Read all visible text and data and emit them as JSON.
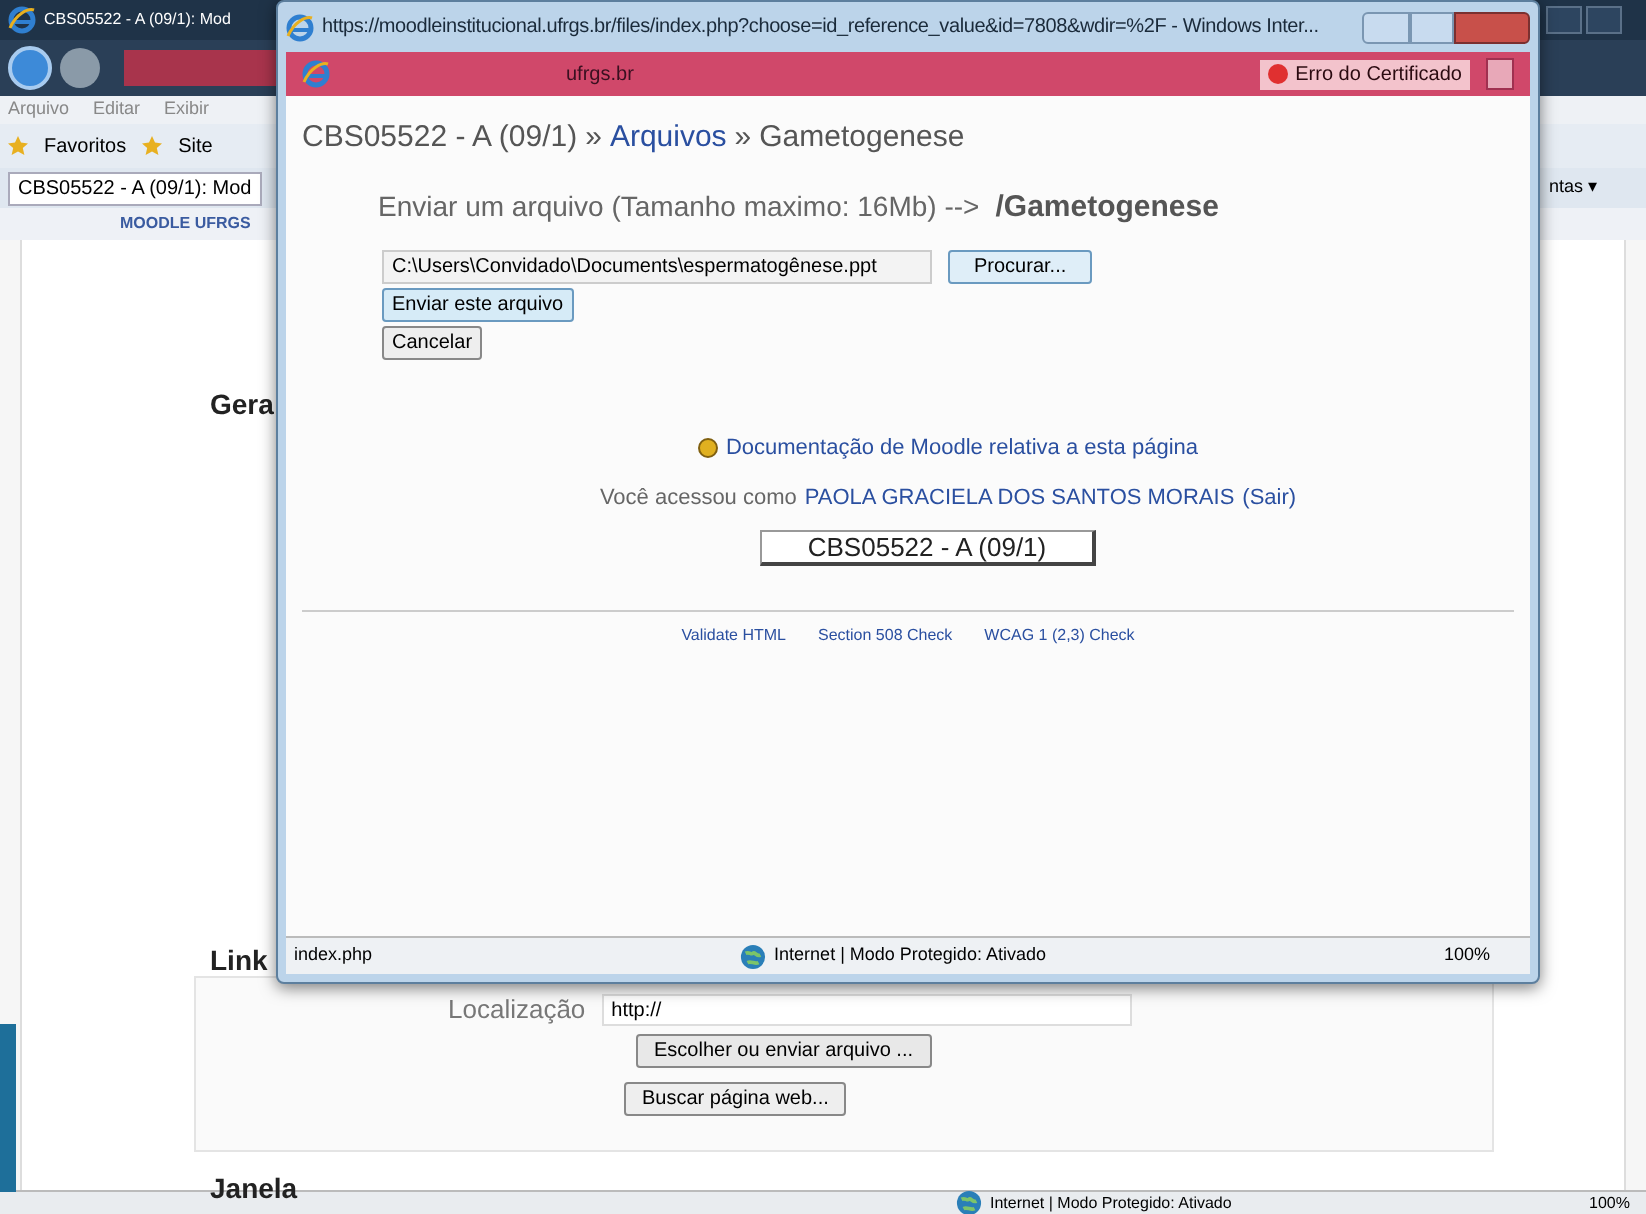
{
  "background_window": {
    "title": "CBS05522 - A (09/1): Mod",
    "menu": [
      "Arquivo",
      "Editar",
      "Exibir"
    ],
    "favorites": {
      "label": "Favoritos",
      "site": "Site"
    },
    "tab": "CBS05522 - A (09/1): Mod",
    "tools": "ntas ▾",
    "header": "MOODLE UFRGS",
    "sections": [
      {
        "label": "Gera"
      },
      {
        "label": "Link"
      },
      {
        "label": "Janela"
      }
    ],
    "location": {
      "label": "Localização",
      "value": "http://"
    },
    "buttons": [
      "Escolher ou enviar arquivo ...",
      "Buscar página web..."
    ],
    "status_bar": {
      "zone": "Internet | Modo Protegido: Ativado",
      "zoom": "100%"
    }
  },
  "popup": {
    "title": "https://moodleinstitucional.ufrgs.br/files/index.php?choose=id_reference_value&id=7808&wdir=%2F - Windows Inter...",
    "address": "ufrgs.br",
    "certificate_error": "Erro do Certificado",
    "breadcrumb_separator": "»",
    "breadcrumb": [
      {
        "label": "CBS05522 - A (09/1)",
        "link": false
      },
      {
        "label": "Arquivos",
        "link": true
      },
      {
        "label": "Gametogenese",
        "link": false
      }
    ],
    "upload_heading": "Enviar um arquivo (Tamanho maximo: 16Mb) -->",
    "folder": "/Gametogenese",
    "file_path": "C:\\Users\\Convidado\\Documents\\espermatogênese.ppt",
    "browse_button": "Procurar...",
    "send_button": "Enviar este arquivo",
    "cancel_button": "Cancelar",
    "doc_link": "Documentação de Moodle relativa a esta página",
    "login_text": "Você acessou como",
    "user": "PAOLA GRACIELA DOS SANTOS MORAIS",
    "logout": "(Sair)",
    "course_button": "CBS05522 - A (09/1)",
    "footer_links": [
      "Validate HTML",
      "Section 508 Check",
      "WCAG 1 (2,3) Check"
    ],
    "status_bar": {
      "url": "index.php",
      "zone": "Internet | Modo Protegido: Ativado",
      "zoom": "100%"
    }
  }
}
